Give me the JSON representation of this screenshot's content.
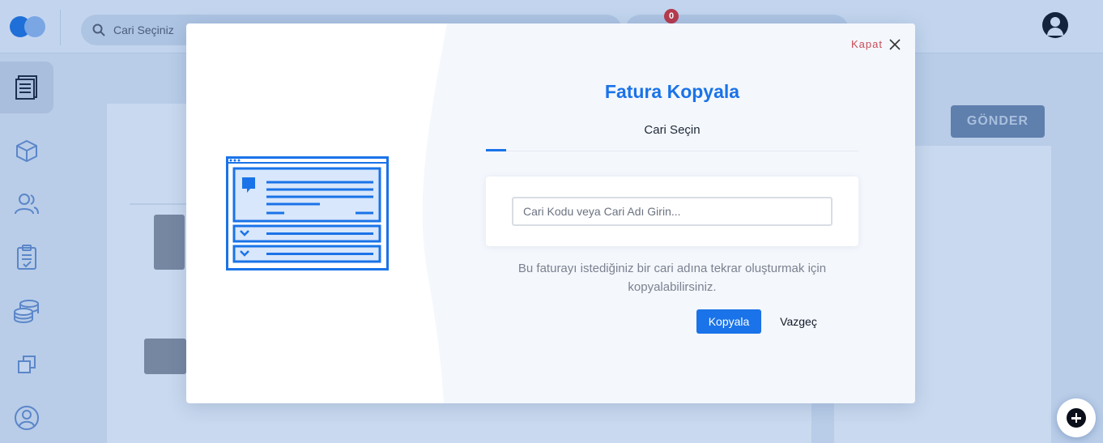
{
  "app": {
    "search_placeholder": "Cari Seçiniz",
    "cart_count": "0"
  },
  "sidebar": {
    "items": [
      {
        "icon": "invoice-icon",
        "active": true
      },
      {
        "icon": "box-icon",
        "active": false
      },
      {
        "icon": "users-icon",
        "active": false
      },
      {
        "icon": "clipboard-icon",
        "active": false
      },
      {
        "icon": "coins-icon",
        "active": false
      },
      {
        "icon": "copy-icon",
        "active": false
      },
      {
        "icon": "user-circle-icon",
        "active": false
      }
    ]
  },
  "background": {
    "send_button": "GÖNDER"
  },
  "modal": {
    "close_label": "Kapat",
    "title": "Fatura Kopyala",
    "tab_label": "Cari Seçin",
    "input_placeholder": "Cari Kodu veya Cari Adı Girin...",
    "info_text": "Bu faturayı istediğiniz bir cari adına tekrar oluşturmak için kopyalabilirsiniz.",
    "copy_button": "Kopyala",
    "cancel_button": "Vazgeç"
  },
  "colors": {
    "accent": "#1a73e8",
    "close": "#c94b57",
    "overlay": "#b9cde8"
  }
}
